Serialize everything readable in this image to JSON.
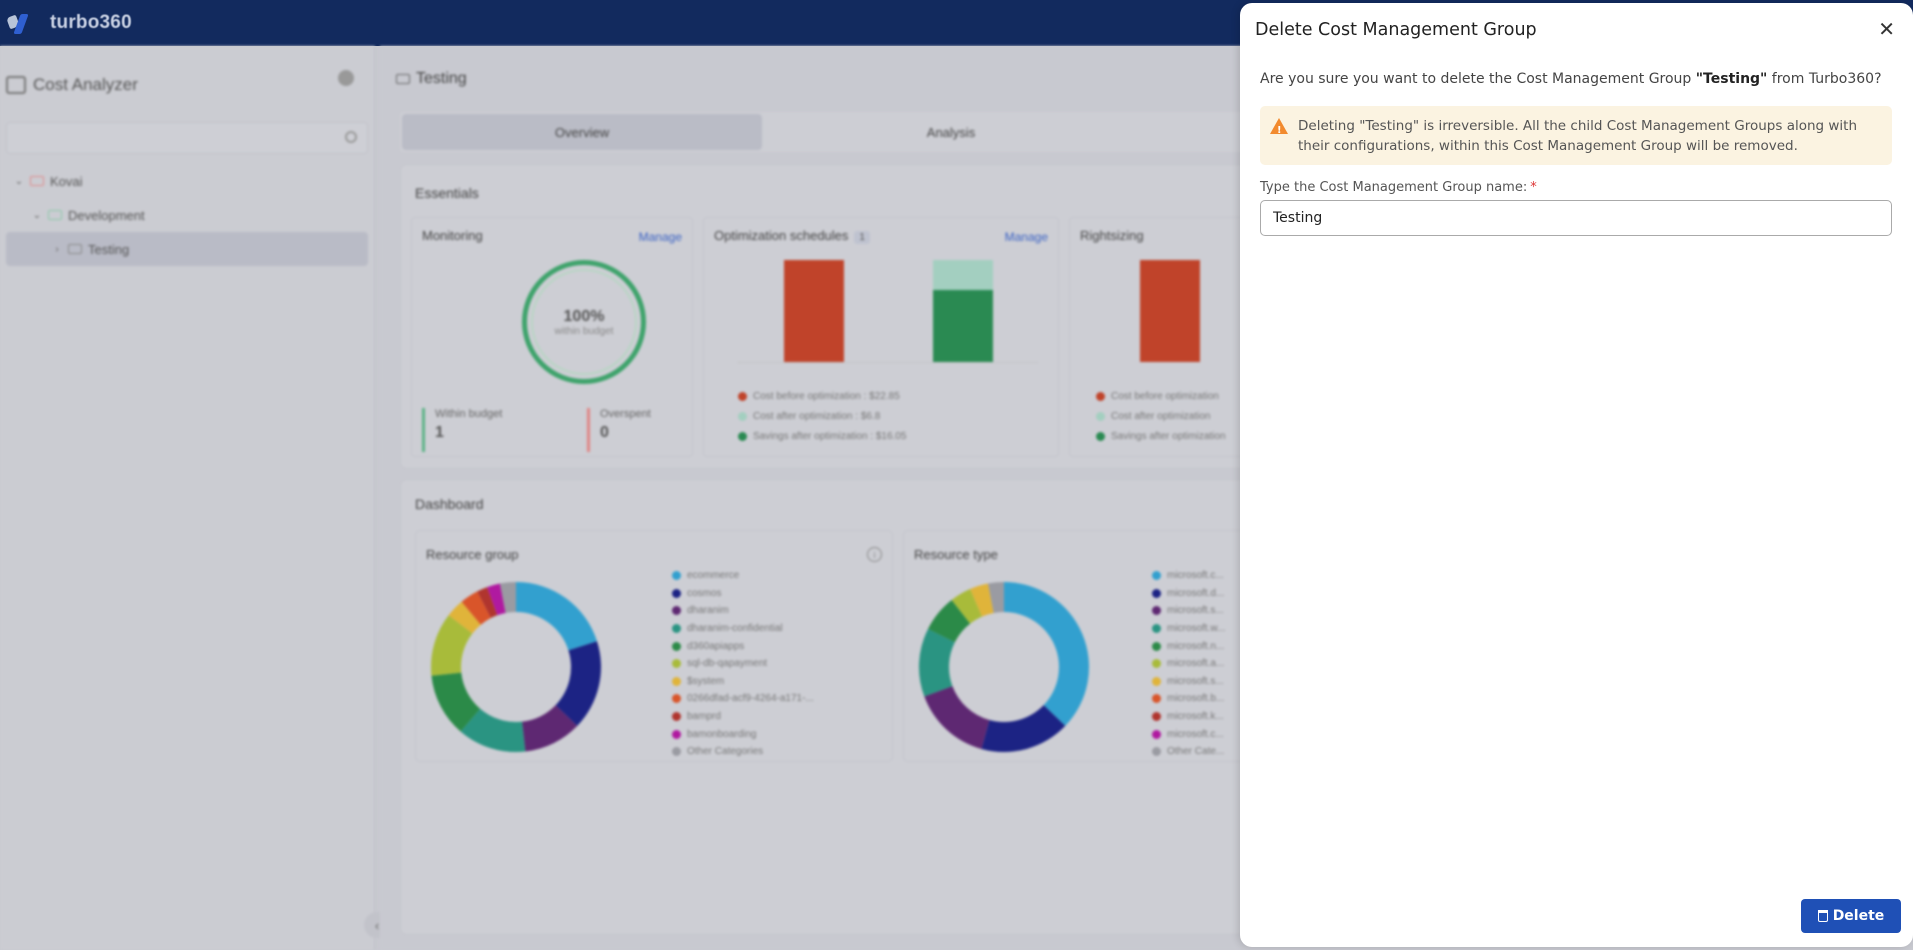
{
  "header": {
    "brand": "turbo360"
  },
  "sidebar": {
    "title": "Cost Analyzer",
    "search_placeholder": "",
    "tree": [
      {
        "label": "Kovai",
        "level": 0,
        "expanded": true
      },
      {
        "label": "Development",
        "level": 1,
        "expanded": true
      },
      {
        "label": "Testing",
        "level": 2,
        "expanded": false,
        "selected": true
      }
    ]
  },
  "main": {
    "breadcrumb": "Testing",
    "tabs": [
      {
        "label": "Overview",
        "active": true
      },
      {
        "label": "Analysis",
        "active": false
      }
    ],
    "essentials": {
      "title": "Essentials",
      "monitoring": {
        "title": "Monitoring",
        "manage": "Manage",
        "gauge_percent": "100%",
        "gauge_label": "within budget",
        "within_budget_label": "Within budget",
        "within_budget_value": "1",
        "overspent_label": "Overspent",
        "overspent_value": "0"
      },
      "optimization": {
        "title": "Optimization schedules",
        "count": "1",
        "manage": "Manage",
        "legend": [
          {
            "label": "Cost before optimization : $22.85",
            "color": "#c0432a"
          },
          {
            "label": "Cost after optimization : $6.8",
            "color": "#a3cfc0"
          },
          {
            "label": "Savings after optimization : $16.05",
            "color": "#2a8a52"
          }
        ]
      },
      "rightsizing": {
        "title": "Rightsizing",
        "legend": [
          {
            "label": "Cost before optimization",
            "color": "#c0432a"
          },
          {
            "label": "Cost after optimization",
            "color": "#a3cfc0"
          },
          {
            "label": "Savings after optimization",
            "color": "#2a8a52"
          }
        ]
      }
    },
    "dashboard": {
      "title": "Dashboard",
      "resource_group": {
        "title": "Resource group",
        "legend": [
          {
            "label": "ecommerce",
            "color": "#32a0cf"
          },
          {
            "label": "cosmos",
            "color": "#1c2384"
          },
          {
            "label": "dharanim",
            "color": "#5e2872"
          },
          {
            "label": "dharanim-confidential",
            "color": "#2a9482"
          },
          {
            "label": "d360apiapps",
            "color": "#2b8a48"
          },
          {
            "label": "sql-db-qapayment",
            "color": "#a8bb3a"
          },
          {
            "label": "$system",
            "color": "#e0b43a"
          },
          {
            "label": "0266dfad-acf9-4264-a171-...",
            "color": "#d9552a"
          },
          {
            "label": "bamprd",
            "color": "#b0352e"
          },
          {
            "label": "bamonboarding",
            "color": "#b01aa0"
          },
          {
            "label": "Other Categories",
            "color": "#9a9ba2"
          }
        ]
      },
      "resource_type": {
        "title": "Resource type",
        "legend": [
          {
            "label": "microsoft.c...",
            "color": "#32a0cf"
          },
          {
            "label": "microsoft.d...",
            "color": "#1c2384"
          },
          {
            "label": "microsoft.s...",
            "color": "#5e2872"
          },
          {
            "label": "microsoft.w...",
            "color": "#2a9482"
          },
          {
            "label": "microsoft.n...",
            "color": "#2b8a48"
          },
          {
            "label": "microsoft.a...",
            "color": "#a8bb3a"
          },
          {
            "label": "microsoft.s...",
            "color": "#e0b43a"
          },
          {
            "label": "microsoft.b...",
            "color": "#d9552a"
          },
          {
            "label": "microsoft.k...",
            "color": "#b0352e"
          },
          {
            "label": "microsoft.c...",
            "color": "#b01aa0"
          },
          {
            "label": "Other Cate...",
            "color": "#9a9ba2"
          }
        ]
      }
    }
  },
  "drawer": {
    "title": "Delete Cost Management Group",
    "question_prefix": "Are you sure you want to delete the Cost Management Group ",
    "question_name": "\"Testing\"",
    "question_suffix": " from Turbo360?",
    "alert": "Deleting \"Testing\" is irreversible. All the child Cost Management Groups along with their configurations, within this Cost Management Group will be removed.",
    "input_label": "Type the Cost Management Group name:",
    "required_mark": "*",
    "input_value": "Testing",
    "delete_label": "Delete",
    "accent": "#1f50b6"
  }
}
